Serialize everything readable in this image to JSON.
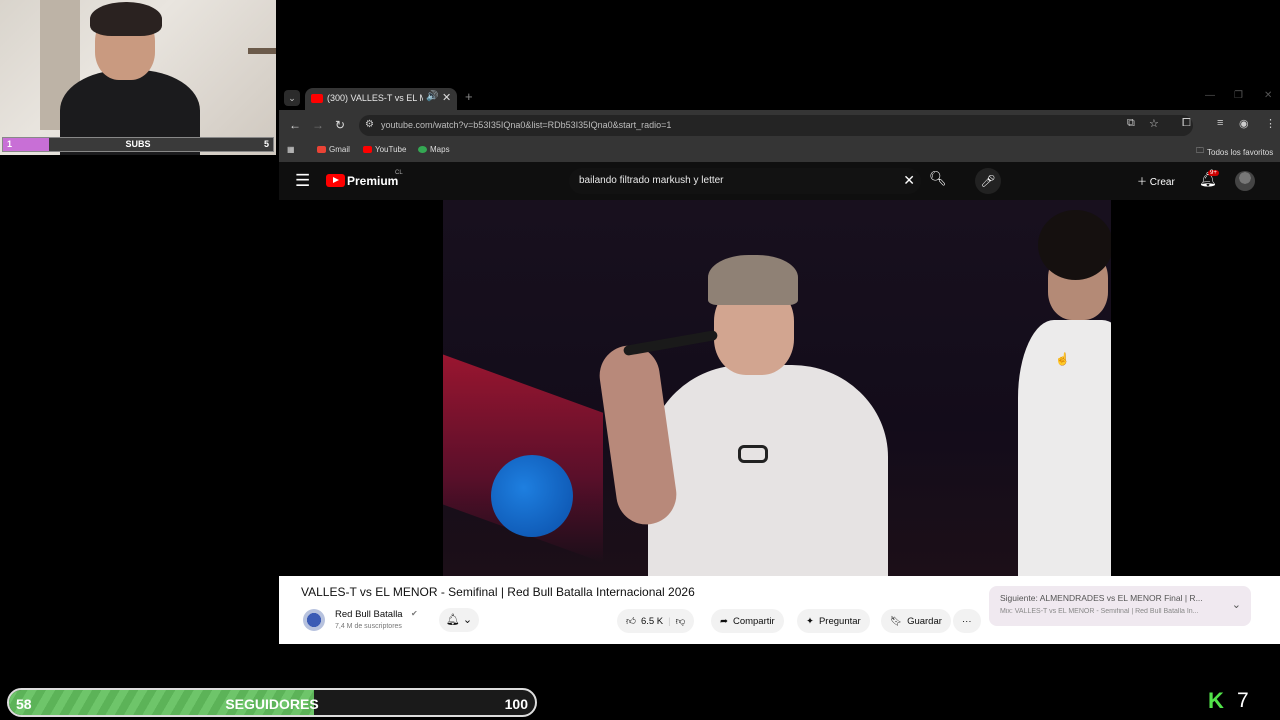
{
  "overlay": {
    "subs": {
      "min": "1",
      "label": "SUBS",
      "max": "5",
      "progress": 0.17
    },
    "followers": {
      "current": "58",
      "label": "SEGUIDORES",
      "goal": "100",
      "progress": 0.58
    },
    "kick_count": "7"
  },
  "browser": {
    "tab_title": "(300) VALLES-T vs EL MENO",
    "url": "youtube.com/watch?v=b53I35IQna0&list=RDb53I35IQna0&start_radio=1",
    "bookmarks": [
      "Gmail",
      "YouTube",
      "Maps"
    ],
    "all_favorites": "Todos los favoritos"
  },
  "youtube": {
    "brand": "Premium",
    "region": "CL",
    "search_query": "bailando filtrado markush y letter",
    "create_label": "Crear",
    "notif_badge": "9+"
  },
  "video": {
    "title": "VALLES-T vs EL MENOR - Semifinal | Red Bull Batalla Internacional 2026",
    "channel": "Red Bull Batalla",
    "subscribers": "7,4 M de suscriptores",
    "likes": "6.5 K",
    "share": "Compartir",
    "ask": "Preguntar",
    "save": "Guardar"
  },
  "up_next": {
    "line1": "Siguiente: ALMENDRADES vs EL MENOR Final | R...",
    "line2": "Mix: VALLES-T vs EL MENOR - Semifinal | Red Bull Batalla In..."
  },
  "colors": {
    "accent": "#ff0000",
    "followers": "#6ec56a",
    "subs": "#c86fd6",
    "kick": "#52e34a"
  }
}
